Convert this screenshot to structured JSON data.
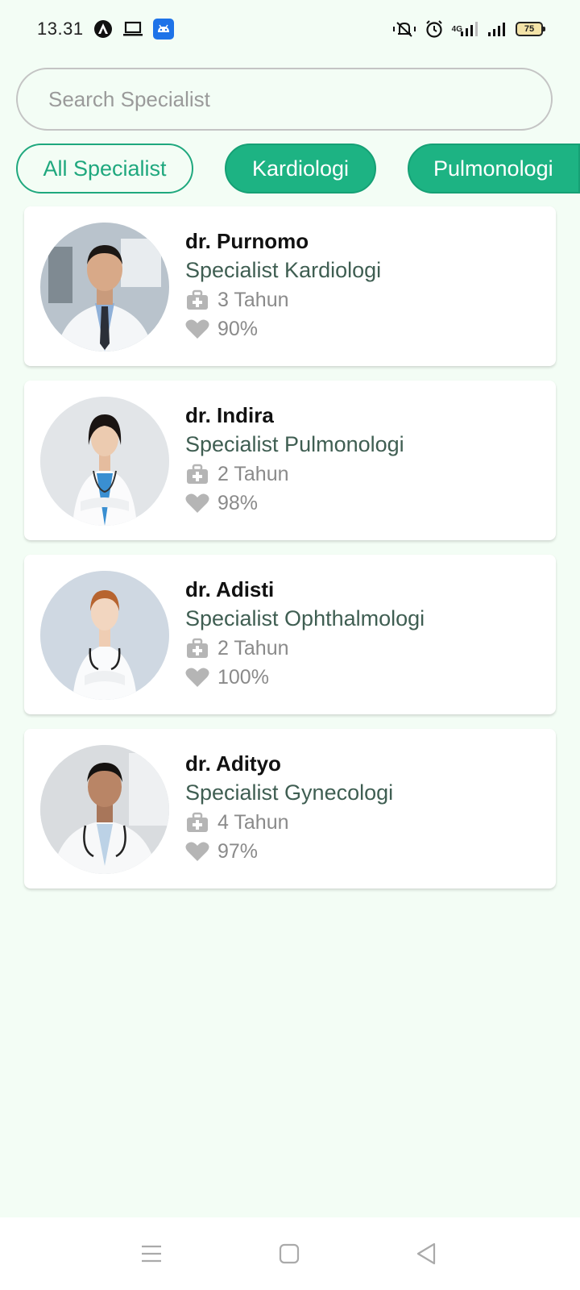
{
  "status_bar": {
    "time": "13.31",
    "battery_level": "75",
    "network_label": "4G",
    "icons": [
      "app-a-icon",
      "laptop-icon",
      "android-icon",
      "vibrate-icon",
      "alarm-icon",
      "signal-4g-icon",
      "signal-icon",
      "battery-icon"
    ]
  },
  "search": {
    "placeholder": "Search Specialist",
    "value": ""
  },
  "filters": [
    {
      "label": "All Specialist",
      "selected": true
    },
    {
      "label": "Kardiologi",
      "selected": false
    },
    {
      "label": "Pulmonologi",
      "selected": false
    }
  ],
  "doctors": [
    {
      "name": "dr. Purnomo",
      "specialty": "Specialist Kardiologi",
      "experience": "3 Tahun",
      "rating": "90%"
    },
    {
      "name": "dr. Indira",
      "specialty": "Specialist Pulmonologi",
      "experience": "2 Tahun",
      "rating": "98%"
    },
    {
      "name": "dr. Adisti",
      "specialty": "Specialist Ophthalmologi",
      "experience": "2 Tahun",
      "rating": "100%"
    },
    {
      "name": "dr. Adityo",
      "specialty": "Specialist Gynecologi",
      "experience": "4 Tahun",
      "rating": "97%"
    }
  ],
  "icons": {
    "experience": "medical-bag-icon",
    "rating": "heart-icon"
  },
  "colors": {
    "accent": "#1db383",
    "background": "#f3fdf5",
    "specialty_text": "#3f5e52",
    "meta_text": "#8a8a8a"
  },
  "nav_bar": {
    "buttons": [
      "menu-icon",
      "home-icon",
      "back-icon"
    ]
  }
}
